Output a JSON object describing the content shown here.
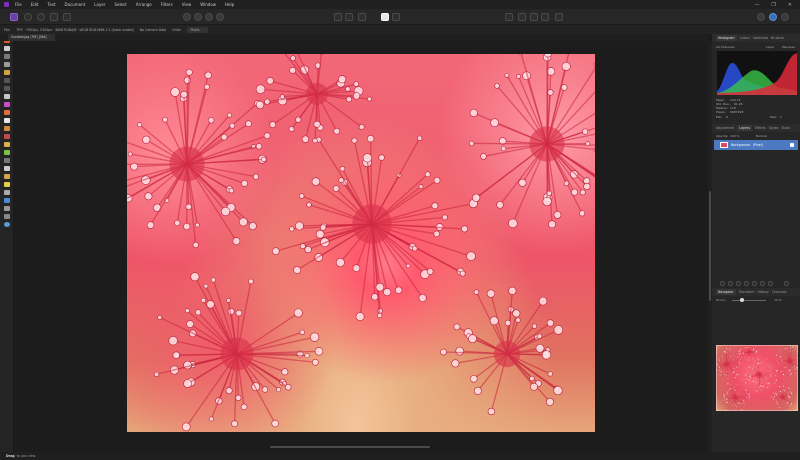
{
  "menubar": {
    "items": [
      "File",
      "Edit",
      "Text",
      "Document",
      "Layer",
      "Select",
      "Arrange",
      "Filters",
      "View",
      "Window",
      "Help"
    ],
    "window_controls": [
      "—",
      "❐",
      "✕"
    ]
  },
  "context_bar": {
    "label_file": "File:",
    "file_info": "TIFF · 7952px, 5304px · 4608 RGBA/8 · sRGB IEC61966-2.1 (black scaled)",
    "camera": "No Camera Data",
    "units_label": "Units:",
    "units_value": "Pixels"
  },
  "document_tab": {
    "title": "Sundew.jpg (Tiff) [Std]"
  },
  "panels": {
    "top_tabs": [
      "Histogram",
      "Colour",
      "Swatches",
      "Brushes"
    ],
    "histogram": {
      "channel": "All Channels",
      "layer_option": "Layer",
      "marquee_option": "Marquee",
      "stats_labels": [
        "Mean:",
        "Std. Dev.:",
        "Median:",
        "Pixels:"
      ],
      "stats_values": [
        "104.74",
        "61.26",
        "118",
        "9987298"
      ],
      "min_label": "Min:",
      "min_value": "0",
      "max_label": "Max:",
      "max_value": "1"
    },
    "mid_tabs": [
      "Adjustment",
      "Layers",
      "Effects",
      "Styles",
      "Stock"
    ],
    "layers": {
      "opacity_label": "Opacity:",
      "opacity_value": "100 %",
      "blend_mode": "Normal",
      "layer_name": "Background",
      "layer_type": "(Pixel)"
    },
    "bottom_tabs": [
      "Navigator",
      "Transform",
      "History",
      "Channels"
    ],
    "navigator": {
      "zoom_label": "Zoom:",
      "zoom_value": "74 %"
    }
  },
  "status": {
    "bold": "Drag",
    "text": "to pan view."
  },
  "colors": {
    "accent_purple": "#7a2fc0",
    "selection_blue": "#4c79c2",
    "toolbar_bg": "#272727"
  }
}
